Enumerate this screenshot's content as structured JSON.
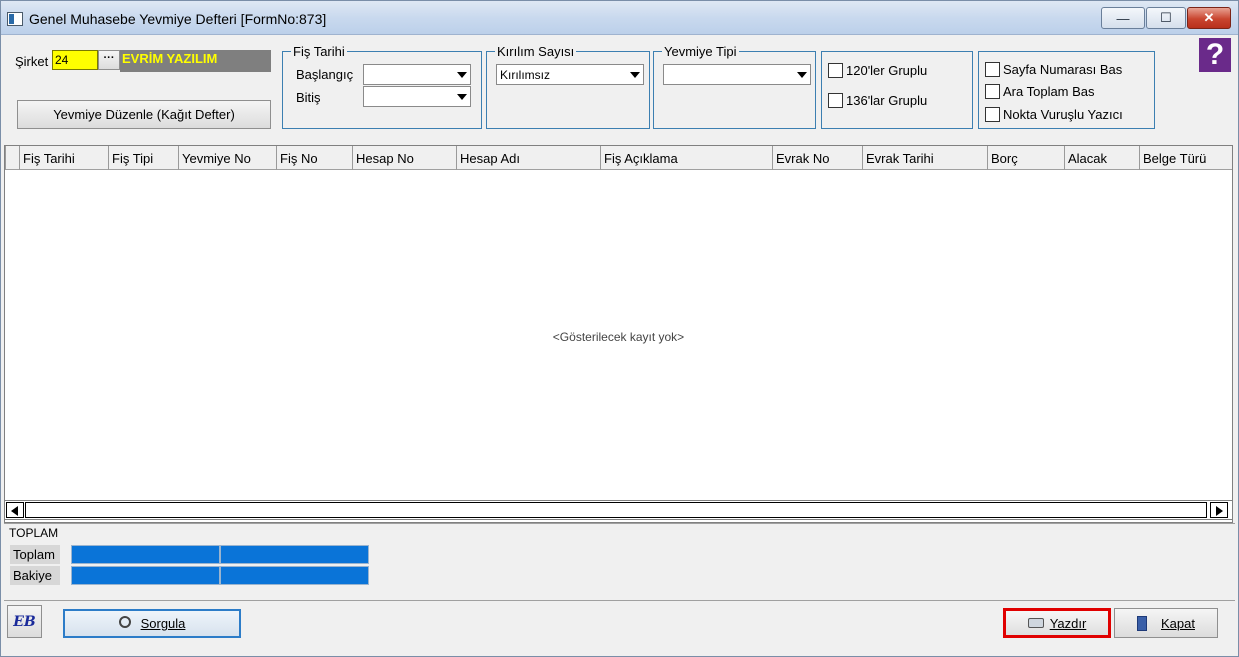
{
  "window": {
    "title": "Genel Muhasebe Yevmiye Defteri [FormNo:873]",
    "min": "—",
    "max": "☐",
    "close": "✕"
  },
  "company": {
    "label": "Şirket",
    "code": "24",
    "lookup": "···",
    "name": "EVRİM YAZILIM"
  },
  "edit_button": "Yevmiye Düzenle (Kağıt Defter)",
  "date_group": {
    "title": "Fiş Tarihi",
    "start_label": "Başlangıç",
    "end_label": "Bitiş",
    "start_value": "",
    "end_value": ""
  },
  "break_group": {
    "title": "Kırılım Sayısı",
    "value": "Kırılımsız"
  },
  "type_group": {
    "title": "Yevmiye Tipi",
    "value": ""
  },
  "group_checks": [
    {
      "label": "120'ler  Gruplu",
      "checked": false
    },
    {
      "label": "136'lar  Gruplu",
      "checked": false
    }
  ],
  "print_checks": [
    {
      "label": "Sayfa Numarası Bas",
      "checked": false
    },
    {
      "label": "Ara Toplam Bas",
      "checked": false
    },
    {
      "label": "Nokta Vuruşlu Yazıcı",
      "checked": false
    }
  ],
  "help": {
    "symbol": "?"
  },
  "grid": {
    "columns": [
      "Fiş Tarihi",
      "Fiş Tipi",
      "Yevmiye No",
      "Fiş No",
      "Hesap No",
      "Hesap Adı",
      "Fiş Açıklama",
      "Evrak No",
      "Evrak Tarihi",
      "Borç",
      "Alacak",
      "Belge Türü"
    ],
    "empty_text": "<Gösterilecek kayıt yok>"
  },
  "totals": {
    "section": "TOPLAM",
    "total_label": "Toplam",
    "balance_label": "Bakiye"
  },
  "buttons": {
    "logo": "EB",
    "query": "Sorgula",
    "print": "Yazdır",
    "close": "Kapat"
  },
  "colors": {
    "accent": "#0a74d8",
    "highlight": "#ffff00",
    "company_bg": "#7f7f7f",
    "company_fg": "#ffff00",
    "print_border": "#e00000",
    "group_border": "#3c7fb1"
  }
}
